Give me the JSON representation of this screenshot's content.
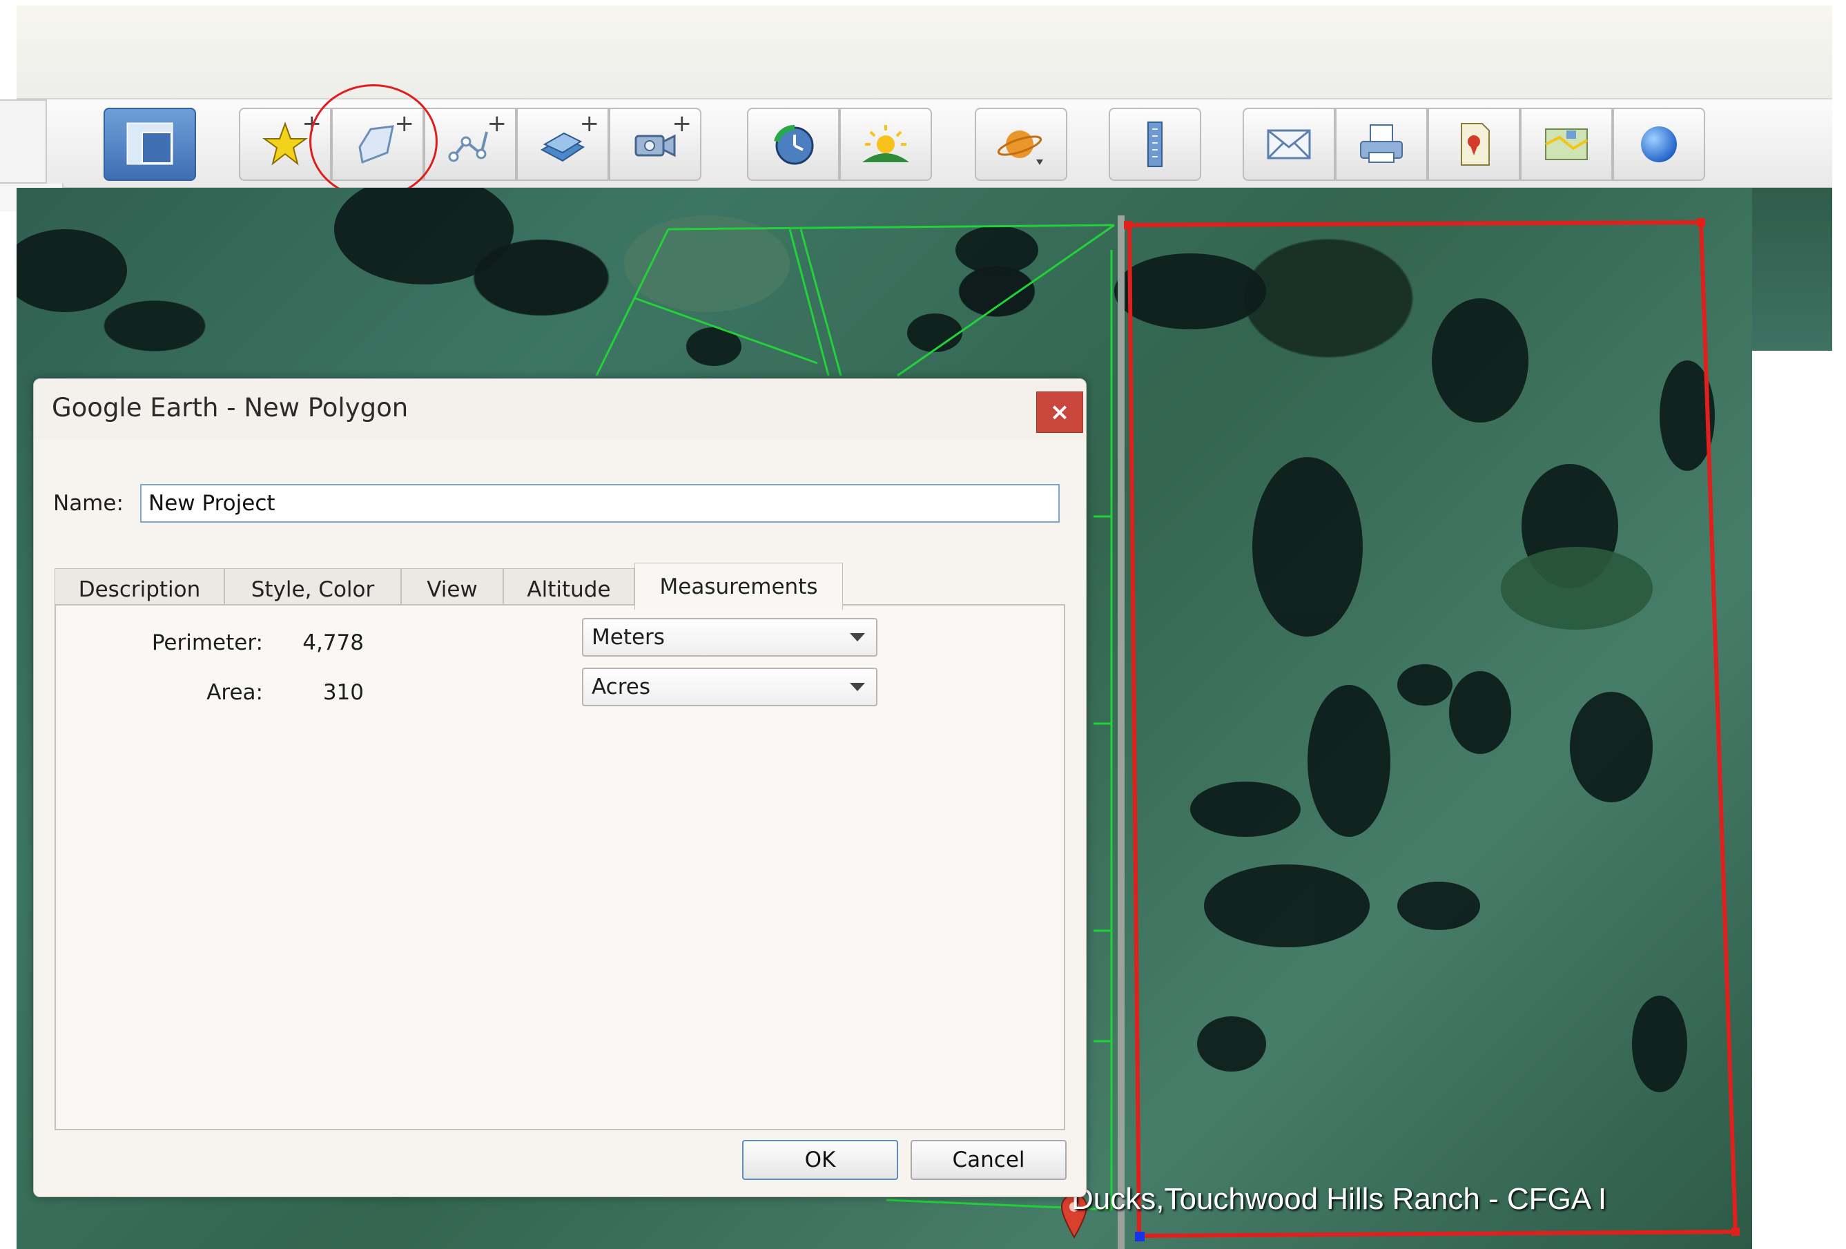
{
  "toolbar": {
    "buttons": [
      {
        "name": "sidebar-toggle",
        "icon": "sidebar-layout-icon"
      },
      {
        "name": "add-placemark",
        "icon": "pushpin-icon"
      },
      {
        "name": "add-polygon",
        "icon": "polygon-icon"
      },
      {
        "name": "add-path",
        "icon": "path-icon"
      },
      {
        "name": "add-image-overlay",
        "icon": "image-overlay-icon"
      },
      {
        "name": "record-tour",
        "icon": "tour-camera-icon"
      },
      {
        "name": "historical-imagery",
        "icon": "clock-icon"
      },
      {
        "name": "sunlight",
        "icon": "sun-icon"
      },
      {
        "name": "switch-planet",
        "icon": "planet-icon"
      },
      {
        "name": "ruler",
        "icon": "ruler-icon"
      },
      {
        "name": "email",
        "icon": "envelope-icon"
      },
      {
        "name": "print",
        "icon": "printer-icon"
      },
      {
        "name": "save-image",
        "icon": "save-image-icon"
      },
      {
        "name": "view-in-maps",
        "icon": "map-icon"
      },
      {
        "name": "sign-in",
        "icon": "globe-icon"
      }
    ],
    "plus_glyph": "+"
  },
  "dialog": {
    "title": "Google Earth - New Polygon",
    "close_glyph": "×",
    "name_label": "Name:",
    "name_value": "New Project",
    "tabs": [
      {
        "label": "Description",
        "active": false
      },
      {
        "label": "Style, Color",
        "active": false
      },
      {
        "label": "View",
        "active": false
      },
      {
        "label": "Altitude",
        "active": false
      },
      {
        "label": "Measurements",
        "active": true
      }
    ],
    "measurements": {
      "perimeter_label": "Perimeter:",
      "perimeter_value": "4,778",
      "perimeter_unit": "Meters",
      "area_label": "Area:",
      "area_value": "310",
      "area_unit": "Acres"
    },
    "ok_label": "OK",
    "cancel_label": "Cancel"
  },
  "map": {
    "caption": "Ducks,Touchwood Hills Ranch - CFGA I",
    "polygon_color": "#e0201c",
    "boundary_color": "#23d13a"
  }
}
